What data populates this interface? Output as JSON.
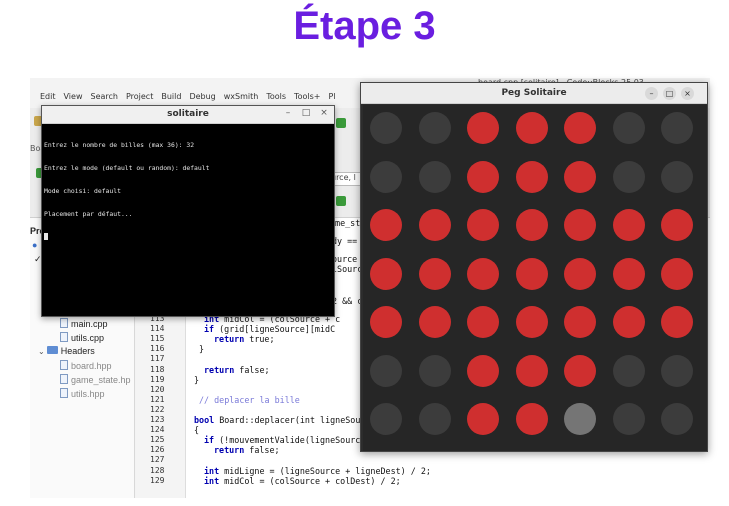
{
  "heading": "Étape 3",
  "ide": {
    "title": "board.cpp [solitaire] - Code::Blocks 25.03",
    "menu": [
      "Edit",
      "View",
      "Search",
      "Project",
      "Build",
      "Debug",
      "wxSmith",
      "Tools",
      "Tools+",
      "Pl"
    ],
    "toolbar_fragments": {
      "boa": "Boa",
      "source_field": "urce, l",
      "proj": "Proj",
      "age": "age",
      "tab": "ame_st",
      "code1": "dy ==",
      "code2": "ource",
      "code3": "lSourc",
      "code4": "2 && c",
      "code5": "midC"
    }
  },
  "project_tree": {
    "files": [
      "main.cpp",
      "utils.cpp"
    ],
    "headers_label": "Headers",
    "headers": [
      "board.hpp",
      "game_state.hp",
      "utils.hpp"
    ]
  },
  "editor": {
    "line_numbers": [
      "113",
      "114",
      "115",
      "116",
      "117",
      "118",
      "119",
      "120",
      "121",
      "122",
      "123",
      "124",
      "125",
      "126",
      "127",
      "128",
      "129"
    ],
    "lines": [
      {
        "kw": "int",
        "text": " midCol = (colSource + c"
      },
      {
        "kw": "if",
        "text": " (grid[ligneSource][midC"
      },
      {
        "kw": "return",
        "text": " true;"
      },
      {
        "kw": "",
        "text": "}"
      },
      {
        "kw": "",
        "text": ""
      },
      {
        "kw": "return",
        "text": " false;"
      },
      {
        "kw": "",
        "text": "}"
      },
      {
        "kw": "",
        "text": ""
      },
      {
        "kw": "",
        "text": "// deplacer la bille"
      },
      {
        "kw": "",
        "text": ""
      },
      {
        "kw": "bool",
        "text": " Board::deplacer(int ligneSour"
      },
      {
        "kw": "",
        "text": "{"
      },
      {
        "kw": "if",
        "text": " (!mouvementValide(ligneSource, colSource, ligneDest, colDest))"
      },
      {
        "kw": "return",
        "text": " false;"
      },
      {
        "kw": "",
        "text": ""
      },
      {
        "kw": "int",
        "text": " midLigne = (ligneSource + ligneDest) / 2;"
      },
      {
        "kw": "int",
        "text": " midCol = (colSource + colDest) / 2;"
      }
    ]
  },
  "terminal": {
    "title": "solitaire",
    "lines": [
      "Entrez le nombre de billes (max 36): 32",
      "Entrez le mode (default ou random): default",
      "Mode choisi: default",
      "Placement par défaut..."
    ]
  },
  "peg_window": {
    "title": "Peg Solitaire",
    "board": [
      [
        0,
        0,
        1,
        1,
        1,
        0,
        0
      ],
      [
        0,
        0,
        1,
        1,
        1,
        0,
        0
      ],
      [
        1,
        1,
        1,
        1,
        1,
        1,
        1
      ],
      [
        1,
        1,
        1,
        1,
        1,
        1,
        1
      ],
      [
        1,
        1,
        1,
        1,
        1,
        1,
        1
      ],
      [
        0,
        0,
        1,
        1,
        1,
        0,
        0
      ],
      [
        0,
        0,
        1,
        1,
        2,
        0,
        0
      ]
    ],
    "colors": {
      "peg": "#cf2f2f",
      "empty": "#3c3c3c",
      "selected": "#757575",
      "background": "#262626"
    }
  }
}
